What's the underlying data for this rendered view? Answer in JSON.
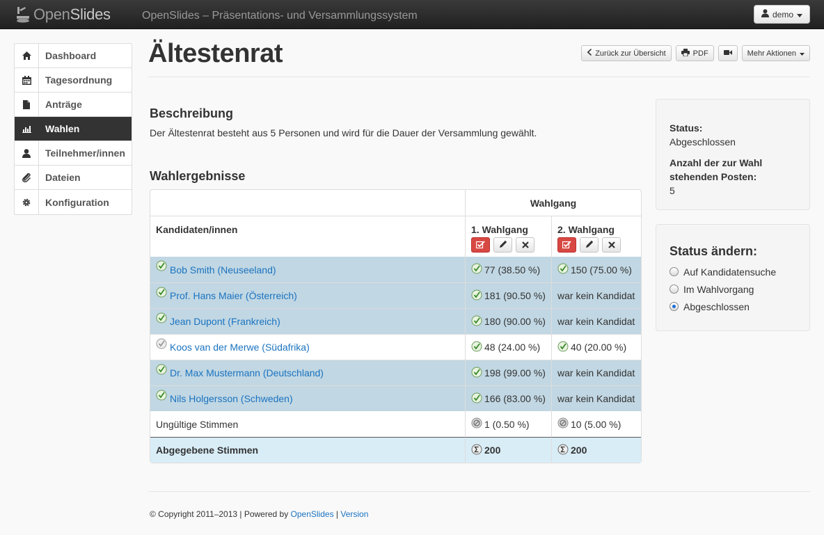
{
  "app": {
    "logo_part1": "Open",
    "logo_part2": "Slides",
    "title": "OpenSlides – Präsentations- und Versammlungssystem",
    "user_label": "demo"
  },
  "sidebar": {
    "items": [
      {
        "label": "Dashboard",
        "icon": "home-icon",
        "active": false
      },
      {
        "label": "Tagesordnung",
        "icon": "calendar-icon",
        "active": false
      },
      {
        "label": "Anträge",
        "icon": "file-icon",
        "active": false
      },
      {
        "label": "Wahlen",
        "icon": "bar-chart-icon",
        "active": true
      },
      {
        "label": "Teilnehmer/innen",
        "icon": "user-icon",
        "active": false
      },
      {
        "label": "Dateien",
        "icon": "paperclip-icon",
        "active": false
      },
      {
        "label": "Konfiguration",
        "icon": "cog-icon",
        "active": false
      }
    ]
  },
  "page": {
    "title": "Ältestenrat",
    "actions": {
      "back": "Zurück zur Übersicht",
      "pdf": "PDF",
      "more": "Mehr Aktionen"
    }
  },
  "description": {
    "heading": "Beschreibung",
    "text": "Der Ältestenrat besteht aus 5 Personen und wird für die Dauer der Versammlung gewählt."
  },
  "results": {
    "heading": "Wahlergebnisse",
    "group_header": "Wahlgang",
    "candidates_header": "Kandidaten/innen",
    "ballots": [
      "1. Wahlgang",
      "2. Wahlgang"
    ],
    "rows": [
      {
        "name": "Bob Smith (Neuseeland)",
        "elected": true,
        "v1": "77 (38.50 %)",
        "v2": "150 (75.00 %)",
        "v2_candidate": true
      },
      {
        "name": "Prof. Hans Maier (Österreich)",
        "elected": true,
        "v1": "181 (90.50 %)",
        "v2": "war kein Kandidat",
        "v2_candidate": false
      },
      {
        "name": "Jean Dupont (Frankreich)",
        "elected": true,
        "v1": "180 (90.00 %)",
        "v2": "war kein Kandidat",
        "v2_candidate": false
      },
      {
        "name": "Koos van der Merwe (Südafrika)",
        "elected": false,
        "v1": "48 (24.00 %)",
        "v2": "40 (20.00 %)",
        "v2_candidate": true
      },
      {
        "name": "Dr. Max Mustermann (Deutschland)",
        "elected": true,
        "v1": "198 (99.00 %)",
        "v2": "war kein Kandidat",
        "v2_candidate": false
      },
      {
        "name": "Nils Holgersson (Schweden)",
        "elected": true,
        "v1": "166 (83.00 %)",
        "v2": "war kein Kandidat",
        "v2_candidate": false
      }
    ],
    "invalid": {
      "label": "Ungültige Stimmen",
      "v1": "1 (0.50 %)",
      "v2": "10 (5.00 %)"
    },
    "cast": {
      "label": "Abgegebene Stimmen",
      "v1": "200",
      "v2": "200"
    }
  },
  "status_panel": {
    "status_label": "Status:",
    "status_value": "Abgeschlossen",
    "posts_label": "Anzahl der zur Wahl stehenden Posten:",
    "posts_value": "5"
  },
  "change_status": {
    "heading": "Status ändern:",
    "options": [
      {
        "label": "Auf Kandidatensuche",
        "selected": false
      },
      {
        "label": "Im Wahlvorgang",
        "selected": false
      },
      {
        "label": "Abgeschlossen",
        "selected": true
      }
    ]
  },
  "footer": {
    "copyright": "© Copyright 2011–2013 | Powered by ",
    "link1": "OpenSlides",
    "sep": " | ",
    "link2": "Version"
  }
}
